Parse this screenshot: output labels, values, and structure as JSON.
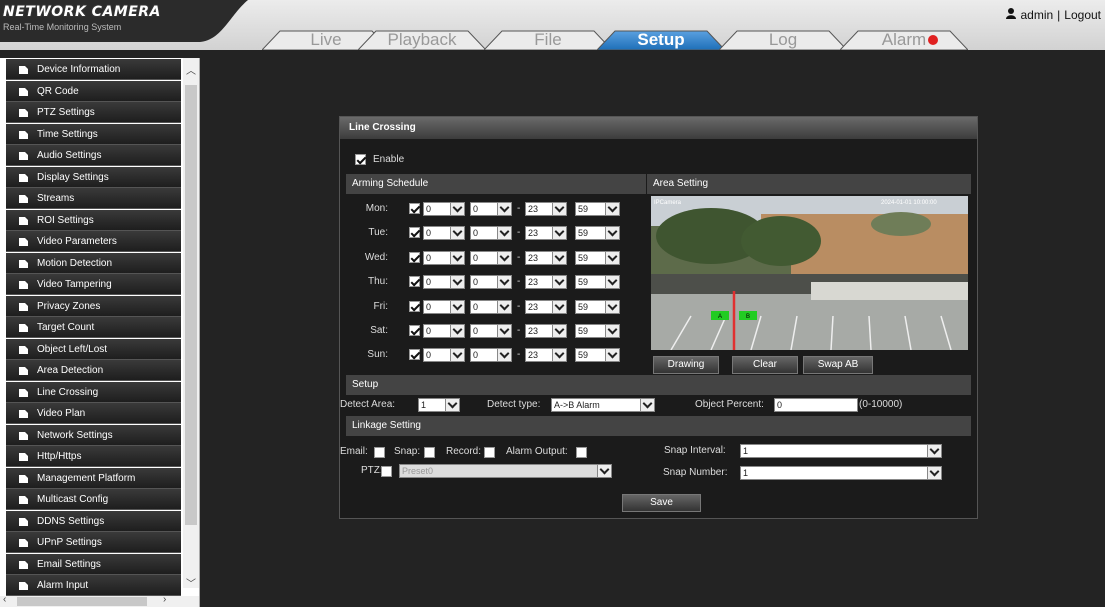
{
  "app": {
    "logo": "NETWORK CAMERA",
    "tagline": "Real-Time Monitoring System",
    "user": "admin",
    "separator": "|",
    "logout": "Logout"
  },
  "tabs": [
    {
      "label": "Live",
      "active": false
    },
    {
      "label": "Playback",
      "active": false
    },
    {
      "label": "File",
      "active": false
    },
    {
      "label": "Setup",
      "active": true
    },
    {
      "label": "Log",
      "active": false
    },
    {
      "label": "Alarm",
      "active": false,
      "alarm_indicator": true
    }
  ],
  "sidebar": {
    "items": [
      "Device Information",
      "QR Code",
      "PTZ Settings",
      "Time Settings",
      "Audio Settings",
      "Display Settings",
      "Streams",
      "ROI Settings",
      "Video Parameters",
      "Motion Detection",
      "Video Tampering",
      "Privacy Zones",
      "Target Count",
      "Object Left/Lost",
      "Area Detection",
      "Line Crossing",
      "Video Plan",
      "Network Settings",
      "Http/Https",
      "Management Platform",
      "Multicast Config",
      "DDNS Settings",
      "UPnP Settings",
      "Email Settings",
      "Alarm Input"
    ]
  },
  "panel": {
    "title": "Line Crossing",
    "enable_label": "Enable",
    "enable_checked": true,
    "arming": {
      "title": "Arming Schedule",
      "days": [
        {
          "day": "Mon:",
          "checked": true,
          "start_h": "0",
          "start_m": "0",
          "sep": "-",
          "end_h": "23",
          "end_m": "59"
        },
        {
          "day": "Tue:",
          "checked": true,
          "start_h": "0",
          "start_m": "0",
          "sep": "-",
          "end_h": "23",
          "end_m": "59"
        },
        {
          "day": "Wed:",
          "checked": true,
          "start_h": "0",
          "start_m": "0",
          "sep": "-",
          "end_h": "23",
          "end_m": "59"
        },
        {
          "day": "Thu:",
          "checked": true,
          "start_h": "0",
          "start_m": "0",
          "sep": "-",
          "end_h": "23",
          "end_m": "59"
        },
        {
          "day": "Fri:",
          "checked": true,
          "start_h": "0",
          "start_m": "0",
          "sep": "-",
          "end_h": "23",
          "end_m": "59"
        },
        {
          "day": "Sat:",
          "checked": true,
          "start_h": "0",
          "start_m": "0",
          "sep": "-",
          "end_h": "23",
          "end_m": "59"
        },
        {
          "day": "Sun:",
          "checked": true,
          "start_h": "0",
          "start_m": "0",
          "sep": "-",
          "end_h": "23",
          "end_m": "59"
        }
      ]
    },
    "area": {
      "title": "Area Setting",
      "overlay_left": "IPCamera",
      "overlay_right": "2024-01-01 10:00:00",
      "marker_a": "A",
      "marker_b": "B",
      "drawing": "Drawing",
      "clear": "Clear",
      "swap": "Swap AB"
    },
    "setup": {
      "title": "Setup",
      "detect_area_label": "Detect Area:",
      "detect_area_value": "1",
      "detect_type_label": "Detect type:",
      "detect_type_value": "A->B Alarm",
      "object_percent_label": "Object Percent:",
      "object_percent_value": "0",
      "object_percent_range": "(0-10000)"
    },
    "linkage": {
      "title": "Linkage Setting",
      "email": "Email:",
      "snap": "Snap:",
      "record": "Record:",
      "alarm_output": "Alarm Output:",
      "ptz": "PTZ:",
      "ptz_value": "Preset0",
      "snap_interval_label": "Snap Interval:",
      "snap_interval_value": "1",
      "snap_number_label": "Snap Number:",
      "snap_number_value": "1"
    },
    "save": "Save"
  },
  "colors": {
    "accent": "#1e6fb8",
    "background": "#232323",
    "marker": "#22cc22",
    "line": "#e03030"
  }
}
